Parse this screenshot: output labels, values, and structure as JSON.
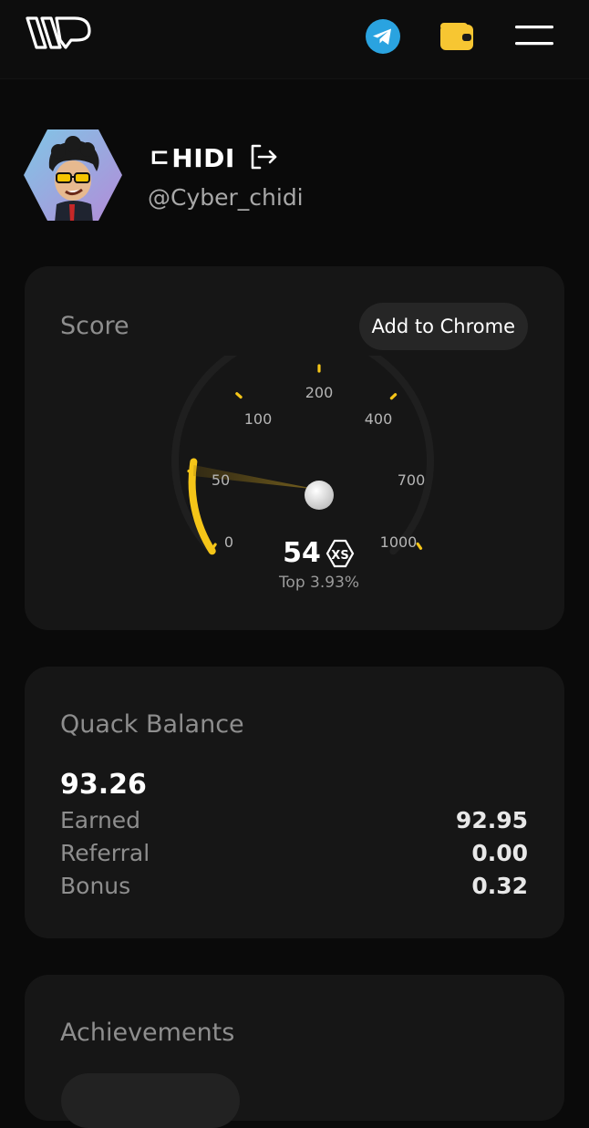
{
  "header": {
    "logo_icon": "brand-logo",
    "telegram_icon": "telegram-icon",
    "wallet_icon": "wallet-icon",
    "menu_icon": "menu-icon",
    "colors": {
      "telegram": "#2aa3e0",
      "wallet": "#f7c632"
    }
  },
  "profile": {
    "name": "ㄷHIDI",
    "handle": "@Cyber_chidi",
    "logout_icon": "logout-icon"
  },
  "score": {
    "title": "Score",
    "add_to_chrome": "Add to Chrome",
    "value": "54",
    "value_numeric": 54,
    "rank": "Top 3.93%",
    "badge_icon": "xs-logo-icon",
    "ticks": [
      "0",
      "50",
      "100",
      "200",
      "400",
      "700",
      "1000"
    ],
    "accent": "#f5c518"
  },
  "balance": {
    "title": "Quack Balance",
    "total": "93.26",
    "rows": [
      {
        "label": "Earned",
        "value": "92.95"
      },
      {
        "label": "Referral",
        "value": "0.00"
      },
      {
        "label": "Bonus",
        "value": "0.32"
      }
    ]
  },
  "achievements": {
    "title": "Achievements"
  }
}
